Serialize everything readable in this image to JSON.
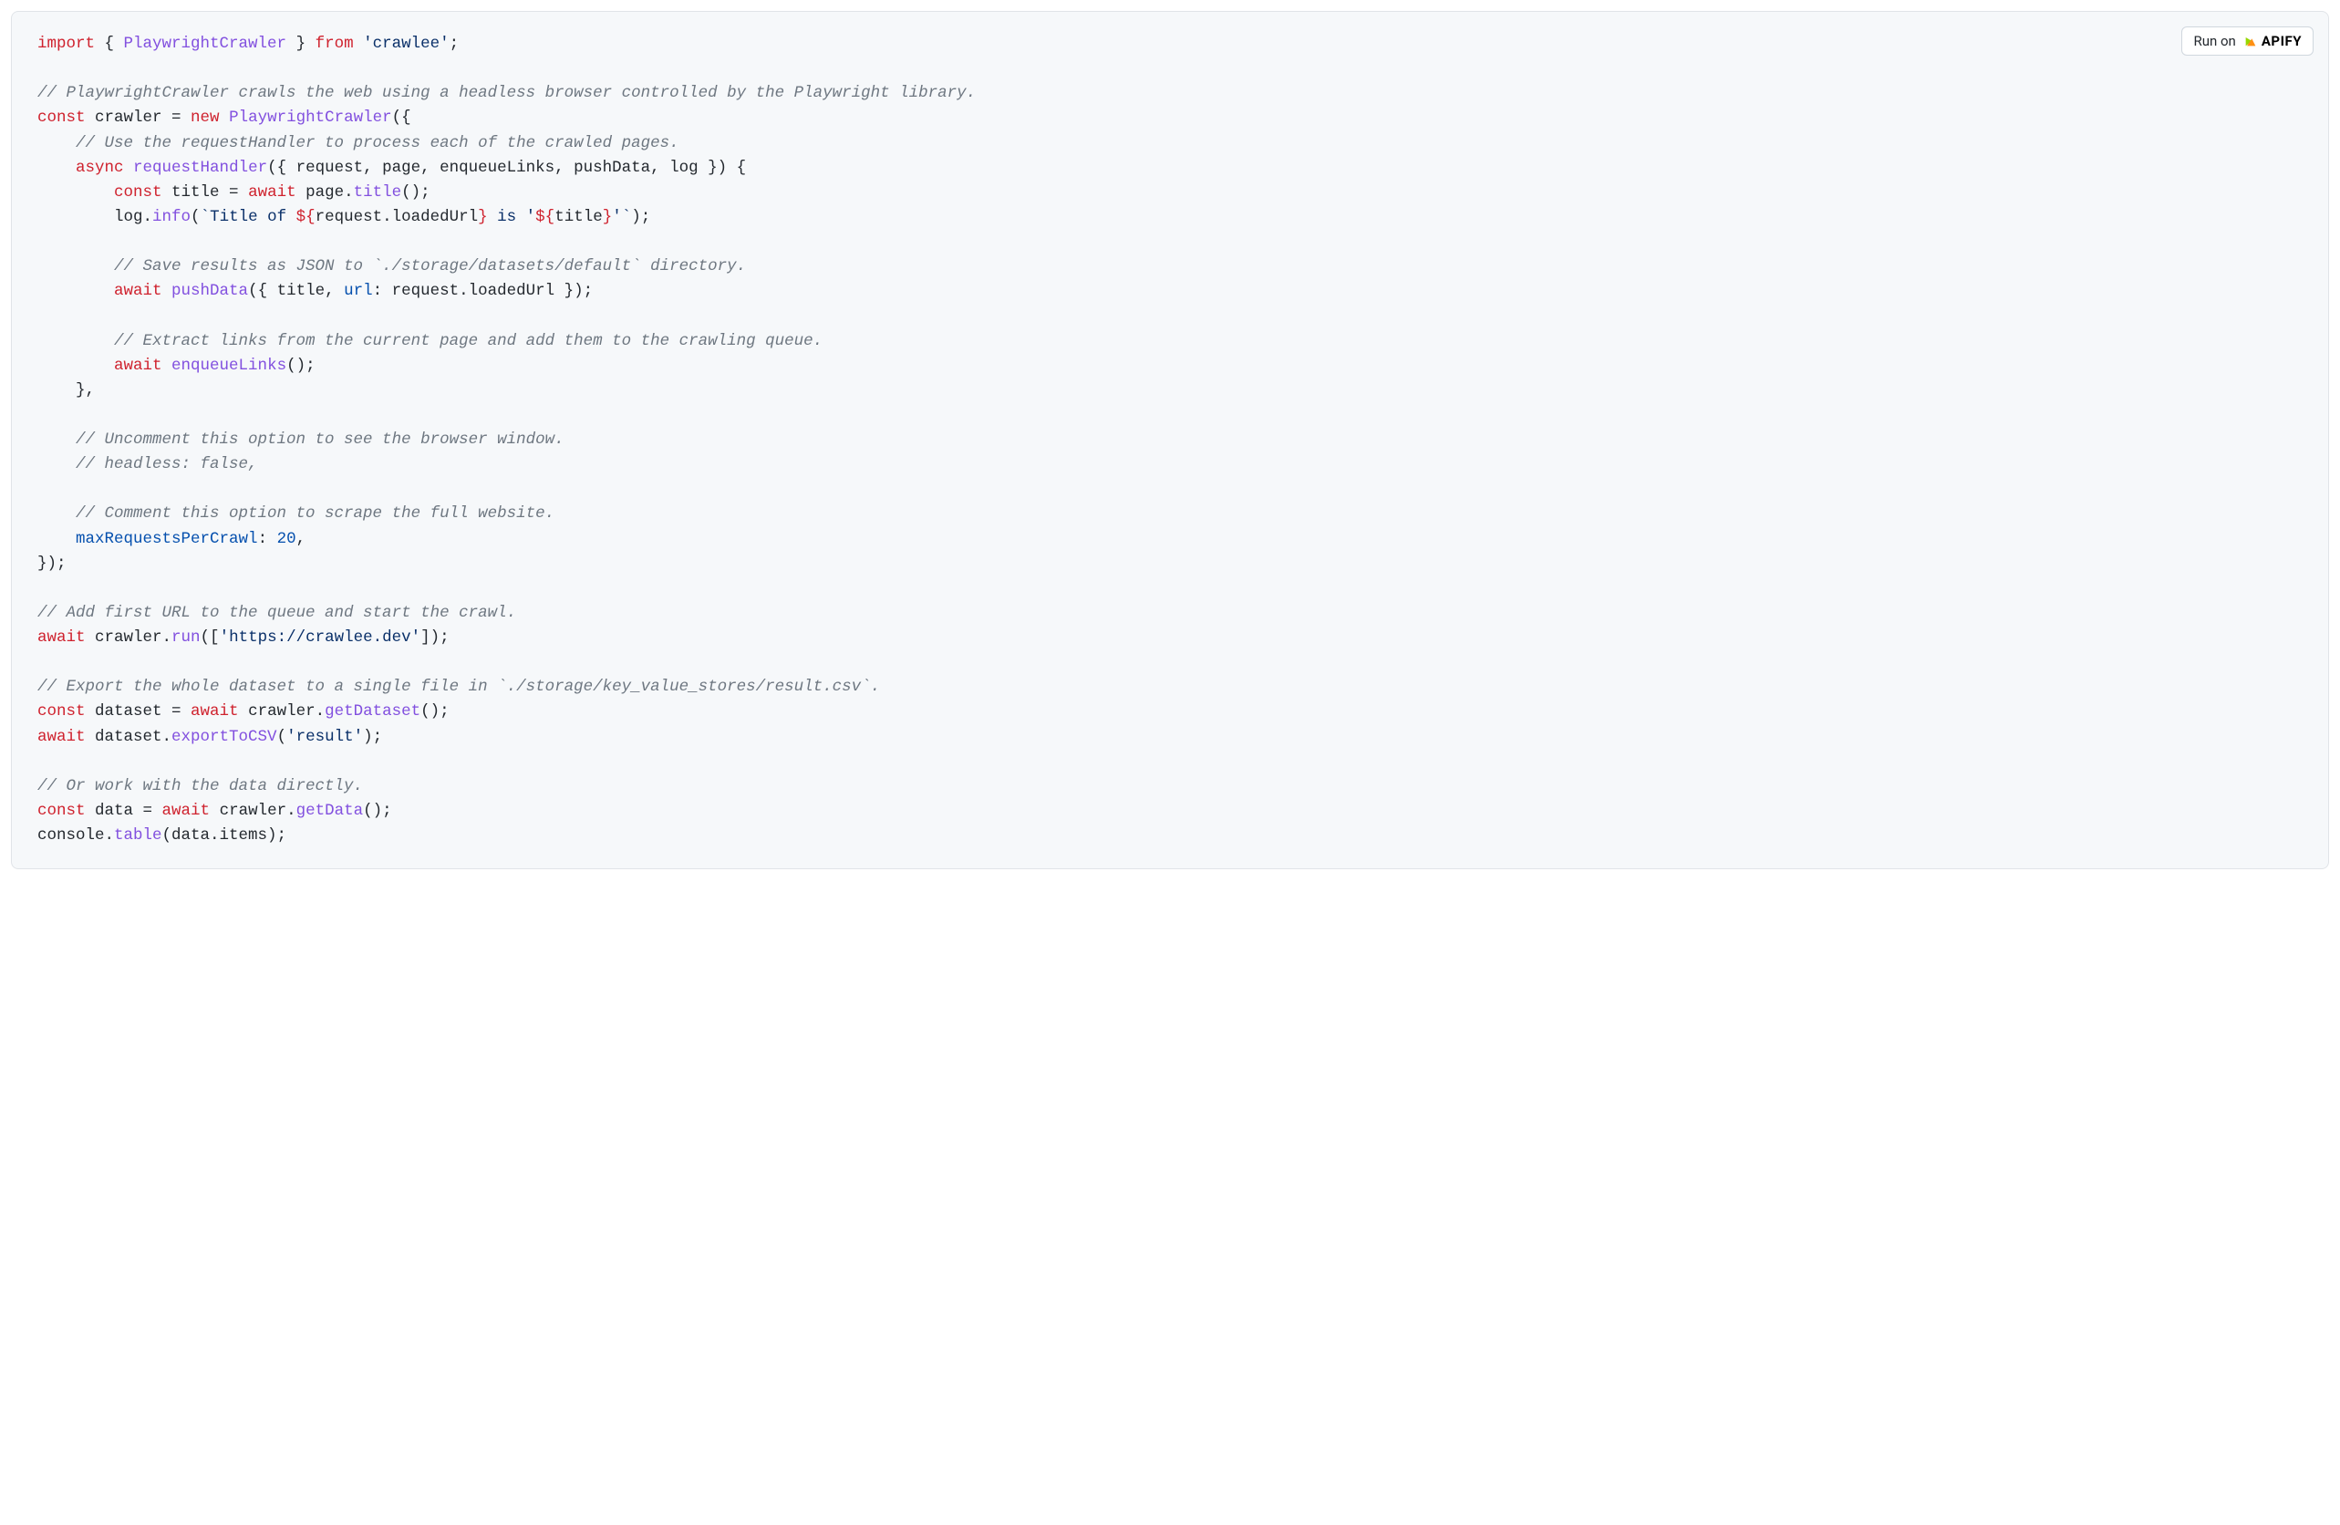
{
  "run_button": {
    "label": "Run on",
    "brand": "APIFY"
  },
  "code": {
    "l1_import": "import",
    "l1_open": " { ",
    "l1_id": "PlaywrightCrawler",
    "l1_close": " } ",
    "l1_from": "from",
    "l1_sp": " ",
    "l1_pkg": "'crawlee'",
    "l1_semi": ";",
    "l3_comment": "// PlaywrightCrawler crawls the web using a headless browser controlled by the Playwright library.",
    "l4_const": "const",
    "l4_name": " crawler ",
    "l4_eq": "= ",
    "l4_new": "new",
    "l4_sp": " ",
    "l4_class": "PlaywrightCrawler",
    "l4_open": "({",
    "l5_comment": "    // Use the requestHandler to process each of the crawled pages.",
    "l6_indent": "    ",
    "l6_async": "async",
    "l6_sp": " ",
    "l6_fn": "requestHandler",
    "l6_params": "({ request, page, enqueueLinks, pushData, log }) {",
    "l7_indent": "        ",
    "l7_const": "const",
    "l7_name": " title ",
    "l7_eq": "= ",
    "l7_await": "await",
    "l7_obj": " page.",
    "l7_call": "title",
    "l7_end": "();",
    "l8_indent": "        log.",
    "l8_call": "info",
    "l8_open": "(",
    "l8_tmpl_a": "`Title of ",
    "l8_interp1_open": "${",
    "l8_interp1_body": "request.loadedUrl",
    "l8_interp1_close": "}",
    "l8_tmpl_b": " is '",
    "l8_interp2_open": "${",
    "l8_interp2_body": "title",
    "l8_interp2_close": "}",
    "l8_tmpl_c": "'`",
    "l8_end": ");",
    "l10_comment": "        // Save results as JSON to `./storage/datasets/default` directory.",
    "l11_indent": "        ",
    "l11_await": "await",
    "l11_sp": " ",
    "l11_call": "pushData",
    "l11_args": "({ title, ",
    "l11_url": "url",
    "l11_rest": ": request.loadedUrl });",
    "l13_comment": "        // Extract links from the current page and add them to the crawling queue.",
    "l14_indent": "        ",
    "l14_await": "await",
    "l14_sp": " ",
    "l14_call": "enqueueLinks",
    "l14_end": "();",
    "l15_close": "    },",
    "l17_comment": "    // Uncomment this option to see the browser window.",
    "l18_comment": "    // headless: false,",
    "l20_comment": "    // Comment this option to scrape the full website.",
    "l21_indent": "    ",
    "l21_prop": "maxRequestsPerCrawl",
    "l21_colon": ": ",
    "l21_num": "20",
    "l21_comma": ",",
    "l22_close": "});",
    "l24_comment": "// Add first URL to the queue and start the crawl.",
    "l25_await": "await",
    "l25_obj": " crawler.",
    "l25_call": "run",
    "l25_open": "([",
    "l25_str": "'https://crawlee.dev'",
    "l25_end": "]);",
    "l27_comment": "// Export the whole dataset to a single file in `./storage/key_value_stores/result.csv`.",
    "l28_const": "const",
    "l28_name": " dataset ",
    "l28_eq": "= ",
    "l28_await": "await",
    "l28_obj": " crawler.",
    "l28_call": "getDataset",
    "l28_end": "();",
    "l29_await": "await",
    "l29_obj": " dataset.",
    "l29_call": "exportToCSV",
    "l29_open": "(",
    "l29_str": "'result'",
    "l29_end": ");",
    "l31_comment": "// Or work with the data directly.",
    "l32_const": "const",
    "l32_name": " data ",
    "l32_eq": "= ",
    "l32_await": "await",
    "l32_obj": " crawler.",
    "l32_call": "getData",
    "l32_end": "();",
    "l33_a": "console.",
    "l33_call": "table",
    "l33_b": "(data.items);"
  }
}
